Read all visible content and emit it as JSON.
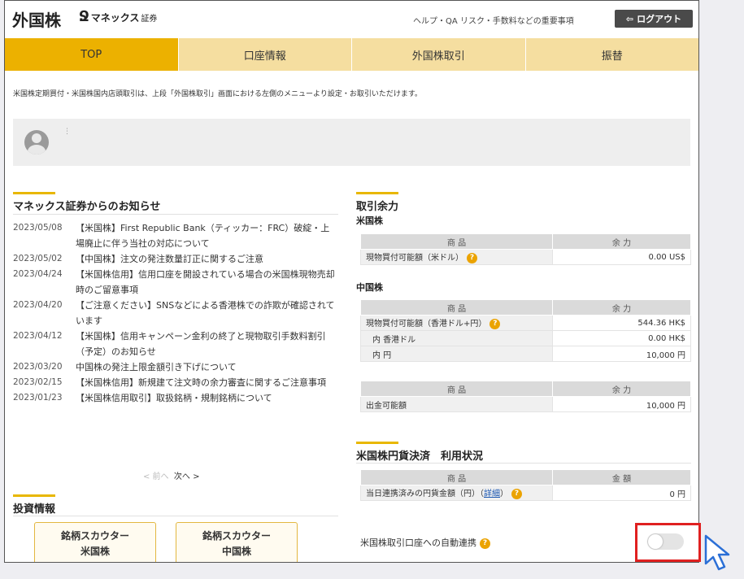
{
  "header": {
    "title": "外国株",
    "logo_text": "マネックス",
    "logo_suffix": "証券",
    "help_link": "ヘルプ・QA",
    "risk_link": "リスク・手数料などの重要事項",
    "logout_label": "ログアウト"
  },
  "nav": {
    "tabs": [
      {
        "label": "TOP"
      },
      {
        "label": "口座情報"
      },
      {
        "label": "外国株取引"
      },
      {
        "label": "振替"
      }
    ]
  },
  "notice": "米国株定期買付・米国株国内店頭取引は、上段「外国株取引」画面における左側のメニューより設定・お取引いただけます。",
  "user": {
    "dots": "⋮"
  },
  "news": {
    "heading": "マネックス証券からのお知らせ",
    "items": [
      {
        "date": "2023/05/08",
        "title": "【米国株】First Republic Bank（ティッカー：FRC）破綻・上場廃止に伴う当社の対応について"
      },
      {
        "date": "2023/05/02",
        "title": "【中国株】注文の発注数量訂正に関するご注意"
      },
      {
        "date": "2023/04/24",
        "title": "【米国株信用】信用口座を開設されている場合の米国株現物売却時のご留意事項"
      },
      {
        "date": "2023/04/20",
        "title": "【ご注意ください】SNSなどによる香港株での詐欺が確認されています"
      },
      {
        "date": "2023/04/12",
        "title": "【米国株】信用キャンペーン金利の終了と現物取引手数料割引（予定）のお知らせ"
      },
      {
        "date": "2023/03/20",
        "title": "中国株の発注上限金額引き下げについて"
      },
      {
        "date": "2023/02/15",
        "title": "【米国株信用】新規建て注文時の余力審査に関するご注意事項"
      },
      {
        "date": "2023/01/23",
        "title": "【米国株信用取引】取扱銘柄・規制銘柄について"
      }
    ],
    "prev_label": "< 前へ",
    "next_label": "次へ >"
  },
  "invest": {
    "heading": "投資情報",
    "buttons": [
      {
        "line1": "銘柄スカウター",
        "line2": "米国株"
      },
      {
        "line1": "銘柄スカウター",
        "line2": "中国株"
      }
    ]
  },
  "margin": {
    "heading": "取引余力",
    "us": {
      "label": "米国株",
      "col_product": "商 品",
      "col_amount": "余 力",
      "rows": [
        {
          "name": "現物買付可能額（米ドル）",
          "value": "0.00 US$"
        }
      ]
    },
    "cn": {
      "label": "中国株",
      "col_product": "商 品",
      "col_amount": "余 力",
      "main": {
        "name": "現物買付可能額（香港ドル+円）",
        "value": "544.36 HK$"
      },
      "sub": [
        {
          "name": "内 香港ドル",
          "value": "0.00 HK$"
        },
        {
          "name": "内 円",
          "value": "10,000 円"
        }
      ]
    },
    "withdraw": {
      "col_product": "商 品",
      "col_amount": "余 力",
      "name": "出金可能額",
      "value": "10,000 円"
    }
  },
  "yen_settle": {
    "heading": "米国株円貨決済　利用状況",
    "col_product": "商 品",
    "col_amount": "金 額",
    "row_name": "当日連携済みの円貨金額（円）",
    "detail_link": "詳細",
    "value": "0 円",
    "auto_link_label": "米国株取引口座への自動連携"
  },
  "colors": {
    "accent": "#ecb100",
    "nav_bg": "#f5dea0",
    "highlight": "#e02020",
    "help_icon": "#eba300"
  }
}
